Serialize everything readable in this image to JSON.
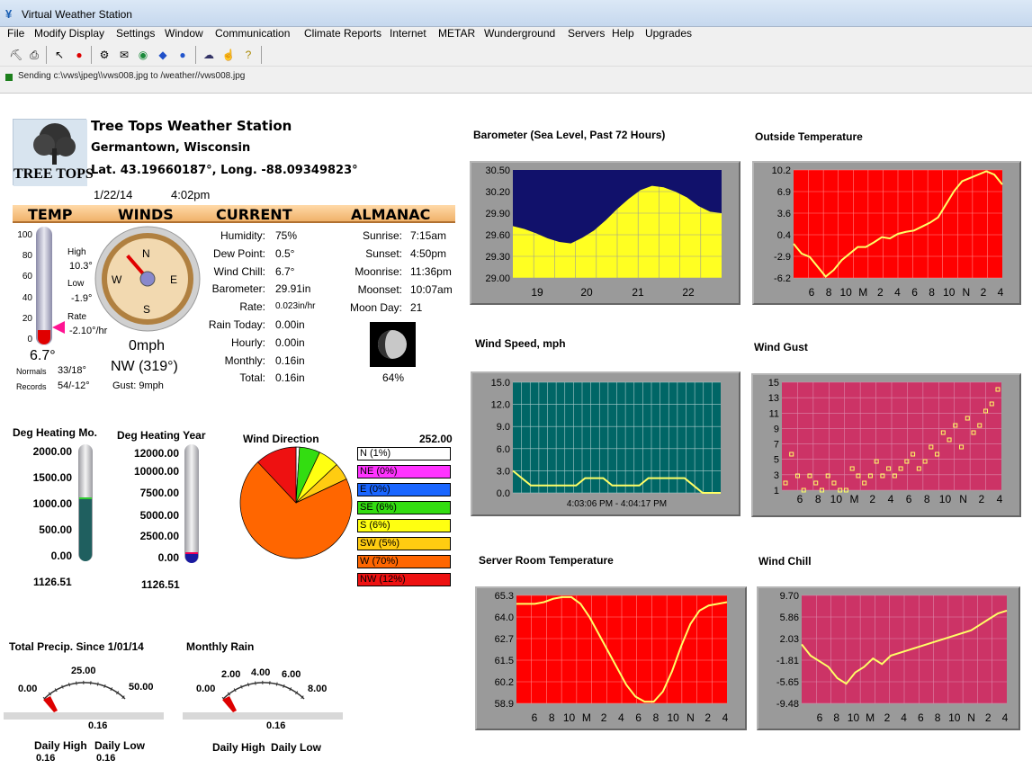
{
  "window": {
    "title": "Virtual Weather Station"
  },
  "menu": [
    "File",
    "Modify Display",
    "Settings",
    "Window",
    "Communication",
    "Climate Reports",
    "Internet",
    "METAR",
    "Wunderground",
    "Servers",
    "Help",
    "Upgrades"
  ],
  "status": "Sending c:\\vws\\jpeg\\\\vws008.jpg to /weather//vws008.jpg",
  "station": {
    "logo_text": "TREE TOPS",
    "name": "Tree Tops Weather Station",
    "location": "Germantown, Wisconsin",
    "coords": "Lat. 43.19660187°, Long. -88.09349823°",
    "date": "1/22/14",
    "time": "4:02pm"
  },
  "headers": {
    "temp": "TEMP",
    "winds": "WINDS",
    "current": "CURRENT",
    "almanac": "ALMANAC"
  },
  "temp": {
    "reading": "6.7°",
    "high_label": "High",
    "high": "10.3°",
    "low_label": "Low",
    "low": "-1.9°",
    "rate_label": "Rate",
    "rate": "-2.10°/hr",
    "normals_label": "Normals",
    "normals": "33/18°",
    "records_label": "Records",
    "records": "54/-12°",
    "scale": [
      "100",
      "80",
      "60",
      "40",
      "20",
      "0"
    ],
    "fill_fraction": 0.067
  },
  "wind": {
    "speed": "0mph",
    "direction": "NW (319°)",
    "gust": "Gust: 9mph",
    "dirs": {
      "n": "N",
      "e": "E",
      "s": "S",
      "w": "W"
    },
    "needle_deg": 319
  },
  "current": [
    {
      "label": "Humidity:",
      "value": "75%"
    },
    {
      "label": "Dew Point:",
      "value": "0.5°"
    },
    {
      "label": "Wind Chill:",
      "value": "6.7°"
    },
    {
      "label": "Barometer:",
      "value": "29.91in"
    },
    {
      "label": "Rate:",
      "value": "0.023in/hr"
    },
    {
      "label": "Rain Today:",
      "value": "0.00in"
    },
    {
      "label": "Hourly:",
      "value": "0.00in"
    },
    {
      "label": "Monthly:",
      "value": "0.16in"
    },
    {
      "label": "Total:",
      "value": "0.16in"
    }
  ],
  "almanac": [
    {
      "label": "Sunrise:",
      "value": "7:15am"
    },
    {
      "label": "Sunset:",
      "value": "4:50pm"
    },
    {
      "label": "Moonrise:",
      "value": "11:36pm"
    },
    {
      "label": "Moonset:",
      "value": "10:07am"
    },
    {
      "label": "Moon Day:",
      "value": "21"
    }
  ],
  "moon_pct": "64%",
  "heating_mo": {
    "title": "Deg Heating Mo.",
    "scale": [
      "2000.00",
      "1500.00",
      "1000.00",
      "500.00",
      "0.00"
    ],
    "value": "1126.51",
    "fill_fraction": 0.563
  },
  "heating_yr": {
    "title": "Deg Heating Year",
    "scale": [
      "12000.00",
      "10000.00",
      "7500.00",
      "5000.00",
      "2500.00",
      "0.00"
    ],
    "value": "1126.51",
    "fill_fraction": 0.094
  },
  "wind_dir": {
    "title": "Wind Direction",
    "value": "252.00",
    "legend": [
      {
        "label": "N  (1%)",
        "pct": 1,
        "color": "#ffffff"
      },
      {
        "label": "NE (0%)",
        "pct": 0,
        "color": "#ff33ff"
      },
      {
        "label": "E  (0%)",
        "pct": 0,
        "color": "#1a66ff"
      },
      {
        "label": "SE (6%)",
        "pct": 6,
        "color": "#33dd11"
      },
      {
        "label": "S  (6%)",
        "pct": 6,
        "color": "#ffff11"
      },
      {
        "label": "SW (5%)",
        "pct": 5,
        "color": "#ffcc11"
      },
      {
        "label": "W  (70%)",
        "pct": 70,
        "color": "#ff6600"
      },
      {
        "label": "NW (12%)",
        "pct": 12,
        "color": "#ee1111"
      }
    ]
  },
  "precip": {
    "title": "Total Precip. Since 1/01/14",
    "ticks": [
      "0.00",
      "25.00",
      "50.00"
    ],
    "value": "0.16",
    "daily_high_label": "Daily High",
    "daily_low_label": "Daily Low",
    "daily_high": "0.16",
    "daily_low": "0.16"
  },
  "rain": {
    "title": "Monthly Rain",
    "ticks": [
      "0.00",
      "2.00",
      "4.00",
      "6.00",
      "8.00"
    ],
    "value": "0.16",
    "daily_high_label": "Daily High",
    "daily_low_label": "Daily Low"
  },
  "chart_data": [
    {
      "type": "area",
      "title": "Barometer (Sea Level, Past 72 Hours)",
      "ylim": [
        29.0,
        30.5
      ],
      "yticks": [
        "30.50",
        "30.20",
        "29.90",
        "29.60",
        "29.30",
        "29.00"
      ],
      "xticks": [
        "19",
        "20",
        "21",
        "22"
      ],
      "x": [
        0,
        4,
        8,
        12,
        16,
        20,
        24,
        28,
        32,
        36,
        40,
        44,
        48,
        52,
        56,
        60,
        64,
        68,
        72
      ],
      "y": [
        29.72,
        29.68,
        29.62,
        29.55,
        29.5,
        29.48,
        29.56,
        29.66,
        29.8,
        29.96,
        30.1,
        30.22,
        30.28,
        30.26,
        30.2,
        30.12,
        30.0,
        29.92,
        29.9
      ]
    },
    {
      "type": "line",
      "title": "Outside Temperature",
      "ylim": [
        -6.2,
        10.2
      ],
      "yticks": [
        "10.2",
        "6.9",
        "3.6",
        "0.4",
        "-2.9",
        "-6.2"
      ],
      "xticks": [
        "6",
        "8",
        "10",
        "M",
        "2",
        "4",
        "6",
        "8",
        "10",
        "N",
        "2",
        "4"
      ],
      "y": [
        -1.0,
        -2.5,
        -3.0,
        -4.5,
        -6.0,
        -5.0,
        -3.5,
        -2.5,
        -1.5,
        -1.5,
        -0.8,
        0.0,
        -0.2,
        0.5,
        0.8,
        1.0,
        1.6,
        2.2,
        3.0,
        5.0,
        7.0,
        8.5,
        9.0,
        9.5,
        10.0,
        9.5,
        8.0
      ]
    },
    {
      "type": "line",
      "title": "Wind Speed, mph",
      "ylim": [
        0,
        15
      ],
      "yticks": [
        "15.0",
        "12.0",
        "9.0",
        "6.0",
        "3.0",
        "0.0"
      ],
      "xlabel": "4:03:06 PM  -  4:04:17 PM",
      "y": [
        3,
        2,
        1,
        1,
        1,
        1,
        1,
        1,
        2,
        2,
        2,
        1,
        1,
        1,
        1,
        2,
        2,
        2,
        2,
        2,
        1,
        0,
        0,
        0
      ]
    },
    {
      "type": "scatter",
      "title": "Wind Gust",
      "ylim": [
        0,
        15
      ],
      "yticks": [
        "15",
        "13",
        "11",
        "9",
        "7",
        "5",
        "3",
        "1"
      ],
      "xticks": [
        "6",
        "8",
        "10",
        "M",
        "2",
        "4",
        "6",
        "8",
        "10",
        "N",
        "2",
        "4"
      ],
      "y": [
        1,
        5,
        2,
        0,
        2,
        1,
        0,
        2,
        1,
        0,
        0,
        3,
        2,
        1,
        2,
        4,
        2,
        3,
        2,
        3,
        4,
        5,
        3,
        4,
        6,
        5,
        8,
        7,
        9,
        6,
        10,
        8,
        9,
        11,
        12,
        14
      ]
    },
    {
      "type": "line",
      "title": "Server Room Temperature",
      "ylim": [
        58.9,
        65.3
      ],
      "yticks": [
        "65.3",
        "64.0",
        "62.7",
        "61.5",
        "60.2",
        "58.9"
      ],
      "xticks": [
        "6",
        "8",
        "10",
        "M",
        "2",
        "4",
        "6",
        "8",
        "10",
        "N",
        "2",
        "4"
      ],
      "y": [
        64.8,
        64.8,
        64.8,
        64.9,
        65.1,
        65.2,
        65.2,
        64.8,
        64.0,
        63.0,
        62.0,
        61.0,
        60.0,
        59.3,
        59.0,
        59.0,
        59.6,
        60.8,
        62.3,
        63.6,
        64.4,
        64.7,
        64.8,
        64.9
      ]
    },
    {
      "type": "line",
      "title": "Wind Chill",
      "ylim": [
        -9.48,
        9.7
      ],
      "yticks": [
        "9.70",
        "5.86",
        "2.03",
        "-1.81",
        "-5.65",
        "-9.48"
      ],
      "xticks": [
        "6",
        "8",
        "10",
        "M",
        "2",
        "4",
        "6",
        "8",
        "10",
        "N",
        "2",
        "4"
      ],
      "y": [
        1.0,
        -1.0,
        -2.0,
        -3.0,
        -5.0,
        -6.0,
        -4.0,
        -3.0,
        -1.5,
        -2.5,
        -1.0,
        -0.5,
        0.0,
        0.5,
        1.0,
        1.5,
        2.0,
        2.5,
        3.0,
        3.5,
        4.5,
        5.5,
        6.5,
        7.0
      ]
    }
  ]
}
